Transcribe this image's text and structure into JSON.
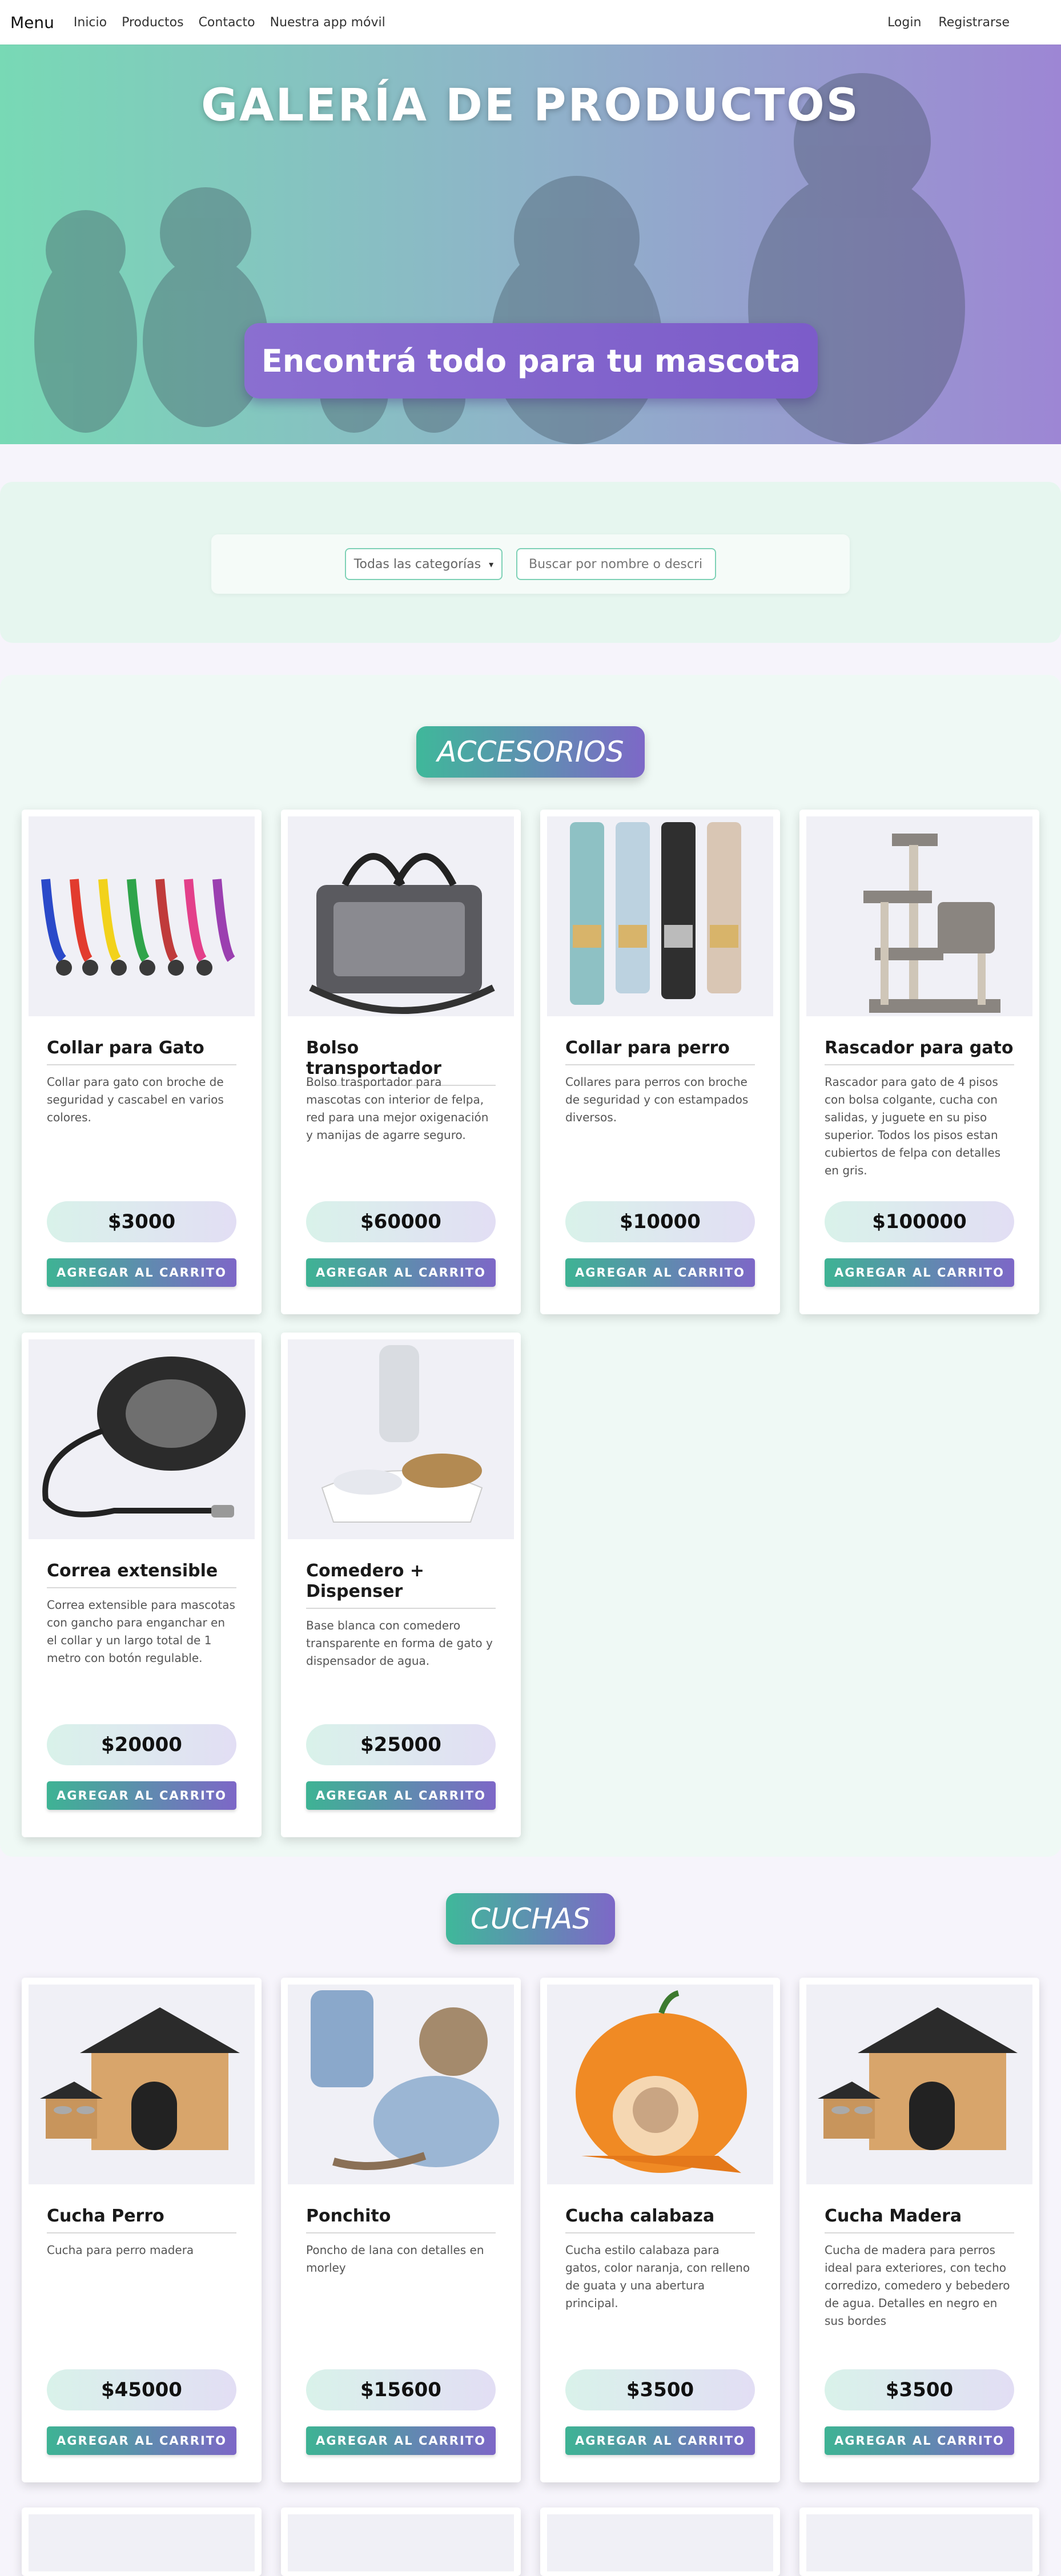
{
  "navbar": {
    "brand": "Menu",
    "links": [
      "Inicio",
      "Productos",
      "Contacto",
      "Nuestra app móvil"
    ],
    "login": "Login",
    "register": "Registrarse"
  },
  "hero": {
    "title": "GALERÍA DE PRODUCTOS",
    "subtitle": "Encontrá todo para tu mascota"
  },
  "filter": {
    "category_selected": "Todas las categorías",
    "search_placeholder": "Buscar por nombre o descripción"
  },
  "cart_label": "AGREGAR AL CARRITO",
  "categories": [
    {
      "name": "ACCESORIOS",
      "products": [
        {
          "title": "Collar para Gato",
          "desc": "Collar para gato con broche de seguridad y cascabel en varios colores.",
          "price": "$3000"
        },
        {
          "title": "Bolso transportador",
          "desc": "Bolso trasportador para mascotas con interior de felpa, red para una mejor oxigenación y manijas de agarre seguro.",
          "price": "$60000"
        },
        {
          "title": "Collar para perro",
          "desc": "Collares para perros con broche de seguridad y con estampados diversos.",
          "price": "$10000"
        },
        {
          "title": "Rascador para gato",
          "desc": "Rascador para gato de 4 pisos con bolsa colgante, cucha con salidas, y juguete en su piso superior. Todos los pisos estan cubiertos de felpa con detalles en gris.",
          "price": "$100000"
        },
        {
          "title": "Correa extensible",
          "desc": "Correa extensible para mascotas con gancho para enganchar en el collar y un largo total de 1 metro con botón regulable.",
          "price": "$20000"
        },
        {
          "title": "Comedero + Dispenser",
          "desc": "Base blanca con comedero transparente en forma de gato y dispensador de agua.",
          "price": "$25000"
        }
      ]
    },
    {
      "name": "CUCHAS",
      "products": [
        {
          "title": "Cucha Perro",
          "desc": "Cucha para perro madera",
          "price": "$45000"
        },
        {
          "title": "Ponchito",
          "desc": "Poncho de lana con detalles en morley",
          "price": "$15600"
        },
        {
          "title": "Cucha calabaza",
          "desc": "Cucha estilo calabaza para gatos, color naranja, con relleno de guata y una abertura principal.",
          "price": "$3500"
        },
        {
          "title": "Cucha Madera",
          "desc": "Cucha de madera para perros ideal para exteriores, con techo corredizo, comedero y bebedero de agua. Detalles en negro en sus bordes",
          "price": "$3500"
        }
      ]
    }
  ]
}
